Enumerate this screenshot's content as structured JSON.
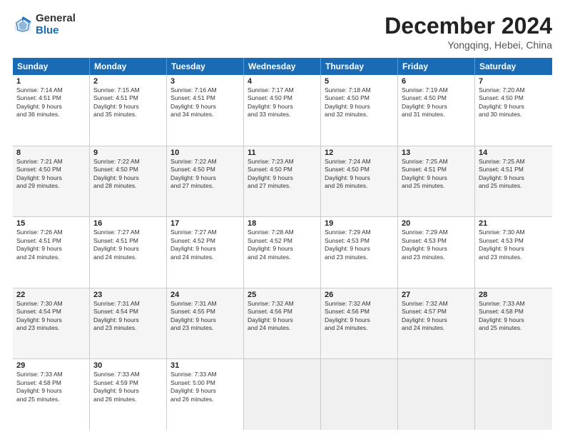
{
  "logo": {
    "general": "General",
    "blue": "Blue"
  },
  "title": "December 2024",
  "subtitle": "Yongqing, Hebei, China",
  "header_days": [
    "Sunday",
    "Monday",
    "Tuesday",
    "Wednesday",
    "Thursday",
    "Friday",
    "Saturday"
  ],
  "weeks": [
    [
      {
        "day": "1",
        "lines": [
          "Sunrise: 7:14 AM",
          "Sunset: 4:51 PM",
          "Daylight: 9 hours",
          "and 36 minutes."
        ]
      },
      {
        "day": "2",
        "lines": [
          "Sunrise: 7:15 AM",
          "Sunset: 4:51 PM",
          "Daylight: 9 hours",
          "and 35 minutes."
        ]
      },
      {
        "day": "3",
        "lines": [
          "Sunrise: 7:16 AM",
          "Sunset: 4:51 PM",
          "Daylight: 9 hours",
          "and 34 minutes."
        ]
      },
      {
        "day": "4",
        "lines": [
          "Sunrise: 7:17 AM",
          "Sunset: 4:50 PM",
          "Daylight: 9 hours",
          "and 33 minutes."
        ]
      },
      {
        "day": "5",
        "lines": [
          "Sunrise: 7:18 AM",
          "Sunset: 4:50 PM",
          "Daylight: 9 hours",
          "and 32 minutes."
        ]
      },
      {
        "day": "6",
        "lines": [
          "Sunrise: 7:19 AM",
          "Sunset: 4:50 PM",
          "Daylight: 9 hours",
          "and 31 minutes."
        ]
      },
      {
        "day": "7",
        "lines": [
          "Sunrise: 7:20 AM",
          "Sunset: 4:50 PM",
          "Daylight: 9 hours",
          "and 30 minutes."
        ]
      }
    ],
    [
      {
        "day": "8",
        "lines": [
          "Sunrise: 7:21 AM",
          "Sunset: 4:50 PM",
          "Daylight: 9 hours",
          "and 29 minutes."
        ]
      },
      {
        "day": "9",
        "lines": [
          "Sunrise: 7:22 AM",
          "Sunset: 4:50 PM",
          "Daylight: 9 hours",
          "and 28 minutes."
        ]
      },
      {
        "day": "10",
        "lines": [
          "Sunrise: 7:22 AM",
          "Sunset: 4:50 PM",
          "Daylight: 9 hours",
          "and 27 minutes."
        ]
      },
      {
        "day": "11",
        "lines": [
          "Sunrise: 7:23 AM",
          "Sunset: 4:50 PM",
          "Daylight: 9 hours",
          "and 27 minutes."
        ]
      },
      {
        "day": "12",
        "lines": [
          "Sunrise: 7:24 AM",
          "Sunset: 4:50 PM",
          "Daylight: 9 hours",
          "and 26 minutes."
        ]
      },
      {
        "day": "13",
        "lines": [
          "Sunrise: 7:25 AM",
          "Sunset: 4:51 PM",
          "Daylight: 9 hours",
          "and 25 minutes."
        ]
      },
      {
        "day": "14",
        "lines": [
          "Sunrise: 7:25 AM",
          "Sunset: 4:51 PM",
          "Daylight: 9 hours",
          "and 25 minutes."
        ]
      }
    ],
    [
      {
        "day": "15",
        "lines": [
          "Sunrise: 7:26 AM",
          "Sunset: 4:51 PM",
          "Daylight: 9 hours",
          "and 24 minutes."
        ]
      },
      {
        "day": "16",
        "lines": [
          "Sunrise: 7:27 AM",
          "Sunset: 4:51 PM",
          "Daylight: 9 hours",
          "and 24 minutes."
        ]
      },
      {
        "day": "17",
        "lines": [
          "Sunrise: 7:27 AM",
          "Sunset: 4:52 PM",
          "Daylight: 9 hours",
          "and 24 minutes."
        ]
      },
      {
        "day": "18",
        "lines": [
          "Sunrise: 7:28 AM",
          "Sunset: 4:52 PM",
          "Daylight: 9 hours",
          "and 24 minutes."
        ]
      },
      {
        "day": "19",
        "lines": [
          "Sunrise: 7:29 AM",
          "Sunset: 4:53 PM",
          "Daylight: 9 hours",
          "and 23 minutes."
        ]
      },
      {
        "day": "20",
        "lines": [
          "Sunrise: 7:29 AM",
          "Sunset: 4:53 PM",
          "Daylight: 9 hours",
          "and 23 minutes."
        ]
      },
      {
        "day": "21",
        "lines": [
          "Sunrise: 7:30 AM",
          "Sunset: 4:53 PM",
          "Daylight: 9 hours",
          "and 23 minutes."
        ]
      }
    ],
    [
      {
        "day": "22",
        "lines": [
          "Sunrise: 7:30 AM",
          "Sunset: 4:54 PM",
          "Daylight: 9 hours",
          "and 23 minutes."
        ]
      },
      {
        "day": "23",
        "lines": [
          "Sunrise: 7:31 AM",
          "Sunset: 4:54 PM",
          "Daylight: 9 hours",
          "and 23 minutes."
        ]
      },
      {
        "day": "24",
        "lines": [
          "Sunrise: 7:31 AM",
          "Sunset: 4:55 PM",
          "Daylight: 9 hours",
          "and 23 minutes."
        ]
      },
      {
        "day": "25",
        "lines": [
          "Sunrise: 7:32 AM",
          "Sunset: 4:56 PM",
          "Daylight: 9 hours",
          "and 24 minutes."
        ]
      },
      {
        "day": "26",
        "lines": [
          "Sunrise: 7:32 AM",
          "Sunset: 4:56 PM",
          "Daylight: 9 hours",
          "and 24 minutes."
        ]
      },
      {
        "day": "27",
        "lines": [
          "Sunrise: 7:32 AM",
          "Sunset: 4:57 PM",
          "Daylight: 9 hours",
          "and 24 minutes."
        ]
      },
      {
        "day": "28",
        "lines": [
          "Sunrise: 7:33 AM",
          "Sunset: 4:58 PM",
          "Daylight: 9 hours",
          "and 25 minutes."
        ]
      }
    ],
    [
      {
        "day": "29",
        "lines": [
          "Sunrise: 7:33 AM",
          "Sunset: 4:58 PM",
          "Daylight: 9 hours",
          "and 25 minutes."
        ]
      },
      {
        "day": "30",
        "lines": [
          "Sunrise: 7:33 AM",
          "Sunset: 4:59 PM",
          "Daylight: 9 hours",
          "and 26 minutes."
        ]
      },
      {
        "day": "31",
        "lines": [
          "Sunrise: 7:33 AM",
          "Sunset: 5:00 PM",
          "Daylight: 9 hours",
          "and 26 minutes."
        ]
      },
      {
        "day": "",
        "lines": []
      },
      {
        "day": "",
        "lines": []
      },
      {
        "day": "",
        "lines": []
      },
      {
        "day": "",
        "lines": []
      }
    ]
  ]
}
